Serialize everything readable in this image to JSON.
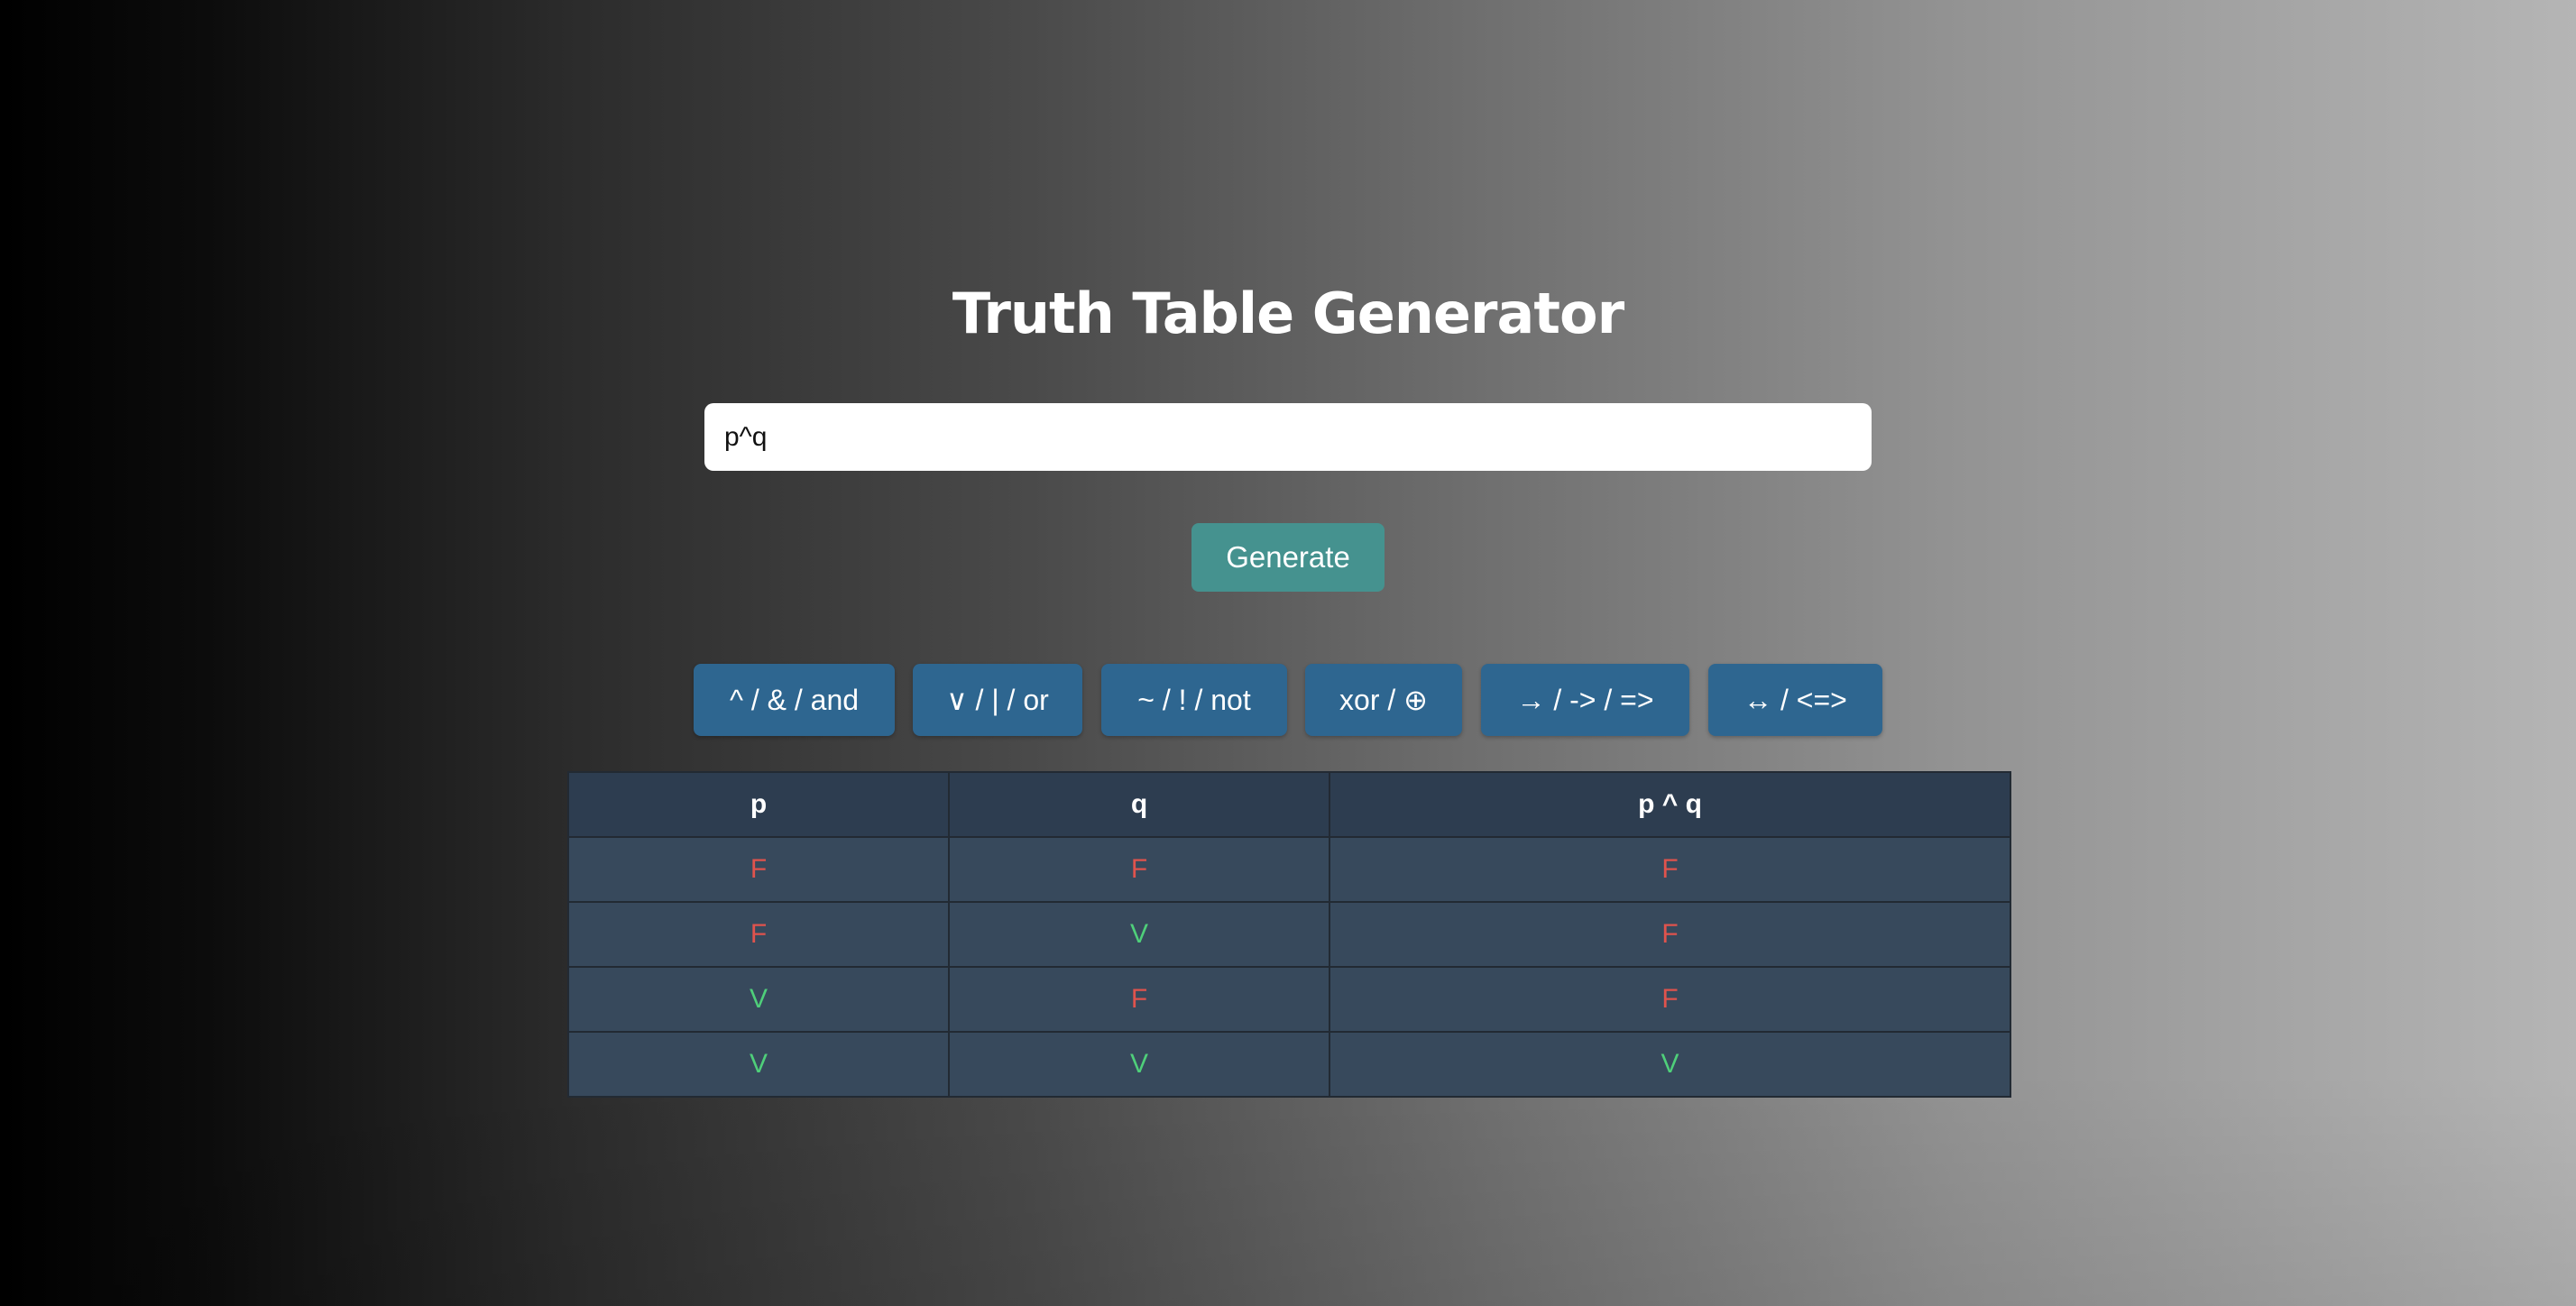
{
  "title": "Truth Table Generator",
  "expression_input": {
    "value": "p^q"
  },
  "generate_label": "Generate",
  "operators": [
    {
      "label": "^ / & / and"
    },
    {
      "label": "∨ / | / or"
    },
    {
      "label": "~ / ! / not"
    },
    {
      "label": "xor / ⊕"
    },
    {
      "label": "→ / -> / =>"
    },
    {
      "label": "↔ / <=>"
    }
  ],
  "table": {
    "headers": [
      "p",
      "q",
      "p ^ q"
    ],
    "rows": [
      [
        "F",
        "F",
        "F"
      ],
      [
        "F",
        "V",
        "F"
      ],
      [
        "V",
        "F",
        "F"
      ],
      [
        "V",
        "V",
        "V"
      ]
    ]
  },
  "colors": {
    "false_value": "#e0534d",
    "true_value": "#4fcf7a",
    "generate_button": "#45928f",
    "operator_button": "#2e6690",
    "table_header": "#2d3d50",
    "table_cell": "#37495c"
  }
}
